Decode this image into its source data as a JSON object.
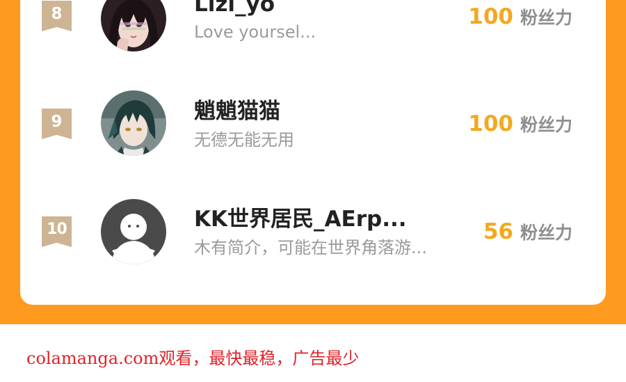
{
  "colors": {
    "background_band": "#FF9A1E",
    "card": "#FFFFFF",
    "rank_badge": "#CDB493",
    "fans_count": "#F3A81E",
    "fans_label": "#8F8F8F",
    "name": "#222222",
    "bio": "#9A9A9A",
    "watermark": "#E0222A"
  },
  "ranking": {
    "entries": [
      {
        "rank": "8",
        "name": "Lizi_yo",
        "bio": "Love yoursel...",
        "fans": "100",
        "fans_label": "粉丝力",
        "avatar_icon": "anime-girl-avatar"
      },
      {
        "rank": "9",
        "name": "魈魈猫猫",
        "bio": "无德无能无用",
        "fans": "100",
        "fans_label": "粉丝力",
        "avatar_icon": "anime-boy-avatar"
      },
      {
        "rank": "10",
        "name": "KK世界居民_AErp...",
        "bio": "木有简介，可能在世界角落游...",
        "fans": "56",
        "fans_label": "粉丝力",
        "avatar_icon": "default-user-avatar"
      }
    ]
  },
  "watermark": {
    "text": "colamanga.com观看，最快最稳，广告最少"
  }
}
